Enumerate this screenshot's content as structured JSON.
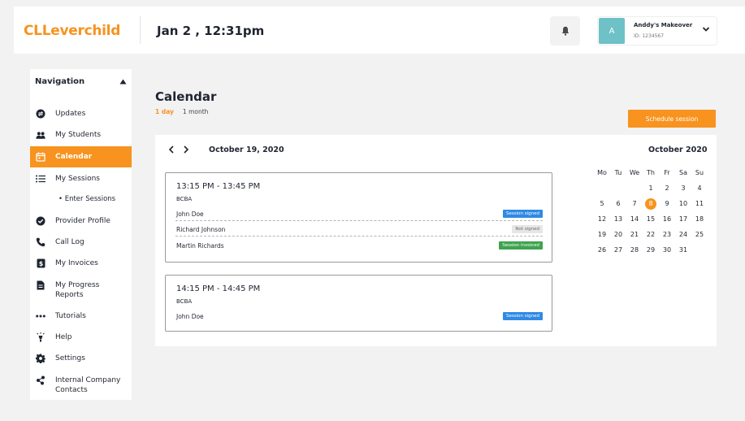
{
  "header": {
    "logo": "CLLeverchild",
    "datetime": "Jan 2 , 12:31pm",
    "user": {
      "initial": "A",
      "name": "Anddy's Makeover",
      "id": "ID: 1234567"
    }
  },
  "sidebar": {
    "title": "Navigation",
    "items": [
      {
        "label": "Updates",
        "icon": "updates-icon"
      },
      {
        "label": "My Students",
        "icon": "students-icon"
      },
      {
        "label": "Calendar",
        "icon": "calendar-icon",
        "active": true
      },
      {
        "label": "My Sessions",
        "icon": "list-icon"
      },
      {
        "label": "Enter Sessions",
        "sub": true
      },
      {
        "label": "Provider Profile",
        "icon": "check-circle-icon"
      },
      {
        "label": "Call Log",
        "icon": "phone-icon"
      },
      {
        "label": "My Invoices",
        "icon": "dollar-icon"
      },
      {
        "label": "My Progress Reports",
        "label_line1": "My Progress",
        "label_line2": "Reports",
        "icon": "document-icon"
      },
      {
        "label": "Tutorials",
        "icon": "dots-icon"
      },
      {
        "label": "Help",
        "icon": "lamp-icon"
      },
      {
        "label": "Settings",
        "icon": "gear-icon"
      },
      {
        "label": "Internal Company Contacts",
        "label_line1": "Internal Company",
        "label_line2": "Contacts",
        "icon": "contacts-icon"
      }
    ]
  },
  "main": {
    "title": "Calendar",
    "tabs": {
      "day": "1 day",
      "month": "1 month"
    },
    "schedule_button": "Schedule session",
    "current_date": "October 19, 2020",
    "sessions": [
      {
        "time": "13:15 PM - 13:45 PM",
        "type": "BCBA",
        "rows": [
          {
            "name": "John Doe",
            "status": "Session signed"
          },
          {
            "name": "Richard Johnson",
            "status": "Not signed"
          },
          {
            "name": "Martin Richards",
            "status": "Session invoiced"
          }
        ]
      },
      {
        "time": "14:15 PM - 14:45 PM",
        "type": "BCBA",
        "rows": [
          {
            "name": "John Doe",
            "status": "Session signed"
          }
        ]
      }
    ],
    "mini_calendar": {
      "title": "October 2020",
      "weekdays": [
        "Mo",
        "Tu",
        "We",
        "Th",
        "Fr",
        "Sa",
        "Su"
      ],
      "weeks": [
        [
          "",
          "",
          "",
          "1",
          "2",
          "3",
          "4"
        ],
        [
          "5",
          "6",
          "7",
          "8",
          "9",
          "10",
          "11"
        ],
        [
          "12",
          "13",
          "14",
          "15",
          "16",
          "17",
          "18"
        ],
        [
          "19",
          "20",
          "21",
          "22",
          "23",
          "24",
          "25"
        ],
        [
          "26",
          "27",
          "28",
          "29",
          "30",
          "31",
          ""
        ]
      ],
      "today": "8"
    }
  },
  "colors": {
    "accent": "#f7931e",
    "signed": "#2f8ae5",
    "invoiced": "#3fa34d",
    "avatar": "#6ec1c6"
  }
}
